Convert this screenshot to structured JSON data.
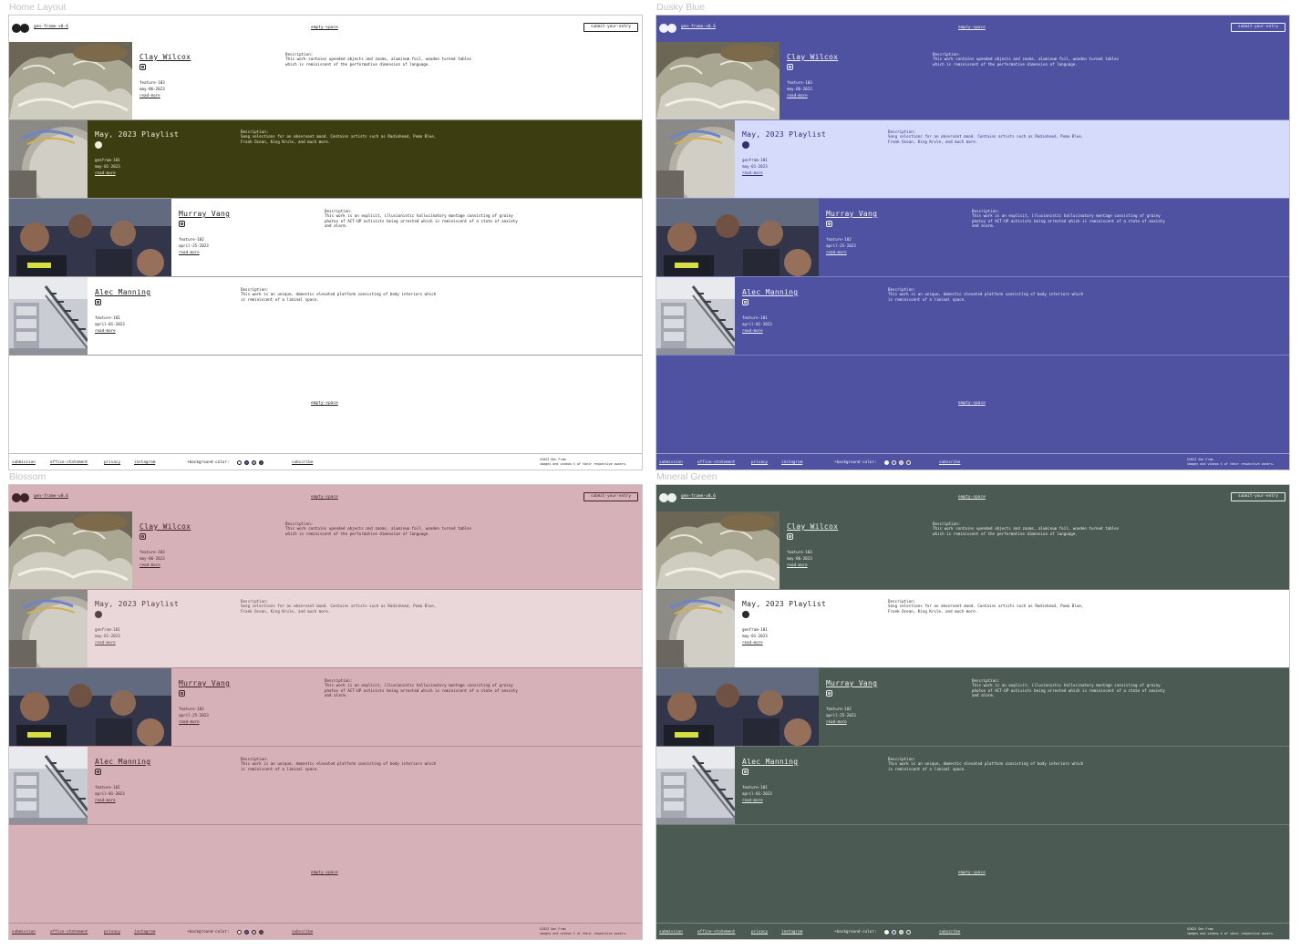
{
  "brand": "gen-frame-v0.6",
  "empty_space": "empty-space",
  "submit": "submit-your-entry",
  "footer": {
    "links": [
      "submission",
      "office-statement",
      "privacy",
      "instagram",
      "subscribe"
    ],
    "bg_label": "+background-color:",
    "copyright": "©2023 Gen Fram",
    "rights": "images and videos © of their respective owners."
  },
  "entries": [
    {
      "id": "clay",
      "title": "Clay Wilcox",
      "icon": "instagram-icon",
      "meta1": "feature-103",
      "meta2": "may-06-2023",
      "link": "read-more",
      "desc_label": "Description:",
      "desc": "This work contains upended objects and zooms, aluminum foil, wooden turned tables which is reminiscent of the performative dimension of language."
    },
    {
      "id": "playlist",
      "title": "May, 2023 Playlist",
      "icon": "spotify-icon",
      "meta1": "genfram-101",
      "meta2": "may-01-2023",
      "link": "read-more",
      "desc_label": "Description:",
      "desc": "Song selections for an observant mood. Contains artists such as Radiohead, Puma Blue, Frank Ocean, King Krule, and much more."
    },
    {
      "id": "murray",
      "title": "Murray Vang",
      "icon": "instagram-icon",
      "meta1": "feature-102",
      "meta2": "april-25-2023",
      "link": "read-more",
      "desc_label": "Description:",
      "desc": "This work is an explicit, illusionistic hallucinatory montage consisting of grainy photos of ACT-UP activists being arrested which is reminiscent of a state of anxiety and alarm."
    },
    {
      "id": "alec",
      "title": "Alec Manning",
      "icon": "instagram-icon",
      "meta1": "feature-101",
      "meta2": "april-01-2023",
      "link": "read-more",
      "desc_label": "Description:",
      "desc": "This work is an unique, domestic elevated platform consisting of body interiors which is reminiscent of a liminal space."
    }
  ],
  "frames": [
    {
      "key": "home",
      "label": "Home Layout",
      "colors": {
        "bg": "#ffffff",
        "fg": "#1e1e1e",
        "feature_bg": "#3c3d10",
        "feature_fg": "#f1f0dc",
        "line": "#9e9e9e",
        "foot_line": "#bdbdbd"
      },
      "swatches": [
        "#ffffff",
        "#5457a4",
        "#c8a7ad",
        "#4a5a50"
      ]
    },
    {
      "key": "dusky",
      "label": "Dusky Blue",
      "colors": {
        "bg": "#4e52a0",
        "fg": "#f2f2ff",
        "feature_bg": "#d7dbfb",
        "feature_fg": "#2e3170",
        "line": "#7d81c4",
        "foot_line": "#9a9ed2"
      },
      "swatches": [
        "#ffffff",
        "#4e52a0",
        "#d8a9b1",
        "#4a5a50"
      ]
    },
    {
      "key": "blossom",
      "label": "Blossom",
      "colors": {
        "bg": "#d7b1b8",
        "fg": "#3d2428",
        "feature_bg": "#ead7da",
        "feature_fg": "#5a3f43",
        "line": "#b58c93",
        "foot_line": "#b58c93"
      },
      "swatches": [
        "#ffffff",
        "#5457a4",
        "#d7b1b8",
        "#4a5a50"
      ]
    },
    {
      "key": "mineral",
      "label": "Mineral Green",
      "colors": {
        "bg": "#4b5a52",
        "fg": "#eef2ee",
        "feature_bg": "#ffffff",
        "feature_fg": "#2b2b2b",
        "line": "#6c7b73",
        "foot_line": "#7a8a82"
      },
      "swatches": [
        "#ffffff",
        "#5457a4",
        "#d7b1b8",
        "#4b5a52"
      ]
    }
  ]
}
